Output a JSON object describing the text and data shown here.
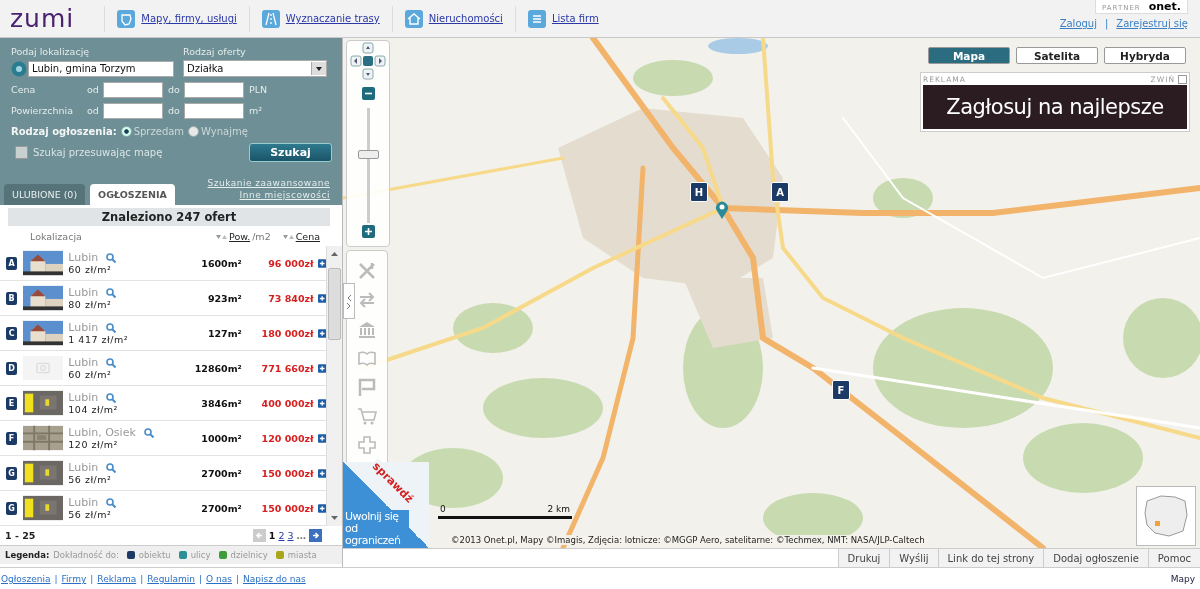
{
  "header": {
    "logo": "zumi",
    "nav": [
      {
        "label": "Mapy, firmy, usługi"
      },
      {
        "label": "Wyznaczanie trasy"
      },
      {
        "label": "Nieruchomości"
      },
      {
        "label": "Lista firm"
      }
    ],
    "partner": {
      "label": "PARTNER",
      "brand": "onet."
    },
    "account_links": [
      {
        "kind": "link",
        "label": "Zaloguj"
      },
      {
        "kind": "separator",
        "label": "|"
      },
      {
        "kind": "link",
        "label": "Zarejestruj się"
      }
    ]
  },
  "search": {
    "location_label": "Podaj lokalizację",
    "location_value": "Lubin, gmina Torzym",
    "offer_type_label": "Rodzaj oferty",
    "offer_type_value": "Działka",
    "price": {
      "label": "Cena",
      "from": "od",
      "to": "do",
      "unit": "PLN"
    },
    "area": {
      "label": "Powierzchnia",
      "from": "od",
      "to": "do",
      "unit": "m²"
    },
    "listing_type": {
      "label": "Rodzaj ogłoszenia:",
      "options": [
        {
          "label": "Sprzedam",
          "selected": true
        },
        {
          "label": "Wynajmę",
          "selected": false
        }
      ]
    },
    "map_search": {
      "label": "Szukaj przesuwając mapę",
      "checked": false
    },
    "submit": "Szukaj",
    "links": [
      "Szukanie zaawansowane",
      "Inne miejscowości"
    ]
  },
  "tabs": [
    {
      "label": "ULUBIONE (0)",
      "selected": false
    },
    {
      "label": "OGŁOSZENIA",
      "selected": true
    }
  ],
  "results": {
    "summary": "Znaleziono 247 ofert",
    "columns": [
      {
        "label": "Lokalizacja",
        "sortable": false
      },
      {
        "label": "Pow.",
        "suffix": "/m2",
        "sortable": true
      },
      {
        "label": "Cena",
        "sortable": true
      }
    ],
    "rows": [
      {
        "marker": "A",
        "kind": "building",
        "location": "Lubin",
        "unit_price": "60 zł/m²",
        "area": "1600m²",
        "price": "96 000zł"
      },
      {
        "marker": "B",
        "kind": "building",
        "location": "Lubin",
        "unit_price": "80 zł/m²",
        "area": "923m²",
        "price": "73 840zł"
      },
      {
        "marker": "C",
        "kind": "building",
        "location": "Lubin",
        "unit_price": "1 417 zł/m²",
        "area": "127m²",
        "price": "180 000zł"
      },
      {
        "marker": "D",
        "kind": "no-photo",
        "location": "Lubin",
        "unit_price": "60 zł/m²",
        "area": "12860m²",
        "price": "771 660zł"
      },
      {
        "marker": "E",
        "kind": "sign",
        "location": "Lubin",
        "unit_price": "104 zł/m²",
        "area": "3846m²",
        "price": "400 000zł"
      },
      {
        "marker": "F",
        "kind": "aerial",
        "location": "Lubin, Osiek",
        "unit_price": "120 zł/m²",
        "area": "1000m²",
        "price": "120 000zł"
      },
      {
        "marker": "G",
        "kind": "sign",
        "location": "Lubin",
        "unit_price": "56 zł/m²",
        "area": "2700m²",
        "price": "150 000zł"
      },
      {
        "marker": "G",
        "kind": "sign",
        "location": "Lubin",
        "unit_price": "56 zł/m²",
        "area": "2700m²",
        "price": "150 000zł"
      }
    ],
    "pagination": {
      "range": "1 - 25",
      "prev_disabled": true,
      "pages": [
        {
          "label": "1",
          "selected": true
        },
        {
          "label": "2",
          "selected": false
        },
        {
          "label": "3",
          "selected": false
        }
      ],
      "more": "…"
    },
    "legend": {
      "label": "Legenda:",
      "accuracy_label": "Dokładność do:",
      "items": [
        {
          "label": "obiektu",
          "color": "#1c3a66"
        },
        {
          "label": "ulicy",
          "color": "#2b8f96"
        },
        {
          "label": "dzielnicy",
          "color": "#3f9c3a"
        },
        {
          "label": "miasta",
          "color": "#a9a61c"
        }
      ]
    }
  },
  "map": {
    "zoom": {
      "level": 0.6
    },
    "type_buttons": [
      {
        "label": "Mapa",
        "selected": true
      },
      {
        "label": "Satelita",
        "selected": false
      },
      {
        "label": "Hybryda",
        "selected": false
      }
    ],
    "ad": {
      "label": "REKLAMA",
      "collapse": "ZWIŃ",
      "text": "Zagłosuj na najlepsze"
    },
    "markers": [
      {
        "label": "H"
      },
      {
        "label": "A"
      },
      {
        "label": "F"
      }
    ],
    "scale": {
      "start": "0",
      "end": "2 km"
    },
    "copyright": "©2013 Onet.pl, Mapy ©Imagis, Zdjęcia: lotnicze: ©MGGP Aero, satelitarne: ©Techmex, NMT: NASA/JLP-Caltech",
    "promo": {
      "tag": "sprawdź",
      "text": "Uwolnij się od ograniczeń"
    }
  },
  "toolbar": [
    "Drukuj",
    "Wyślij",
    "Link do tej strony",
    "Dodaj ogłoszenie",
    "Pomoc"
  ],
  "footer": {
    "links": [
      {
        "kind": "link",
        "label": "Ogłoszenia"
      },
      {
        "kind": "separator",
        "label": "|"
      },
      {
        "kind": "link",
        "label": "Firmy"
      },
      {
        "kind": "separator",
        "label": "|"
      },
      {
        "kind": "link",
        "label": "Reklama"
      },
      {
        "kind": "separator",
        "label": "|"
      },
      {
        "kind": "link",
        "label": "Regulamin"
      },
      {
        "kind": "separator",
        "label": "|"
      },
      {
        "kind": "link",
        "label": "O nas"
      },
      {
        "kind": "separator",
        "label": "|"
      },
      {
        "kind": "link",
        "label": "Napisz do nas"
      }
    ],
    "right": "Mapy"
  }
}
